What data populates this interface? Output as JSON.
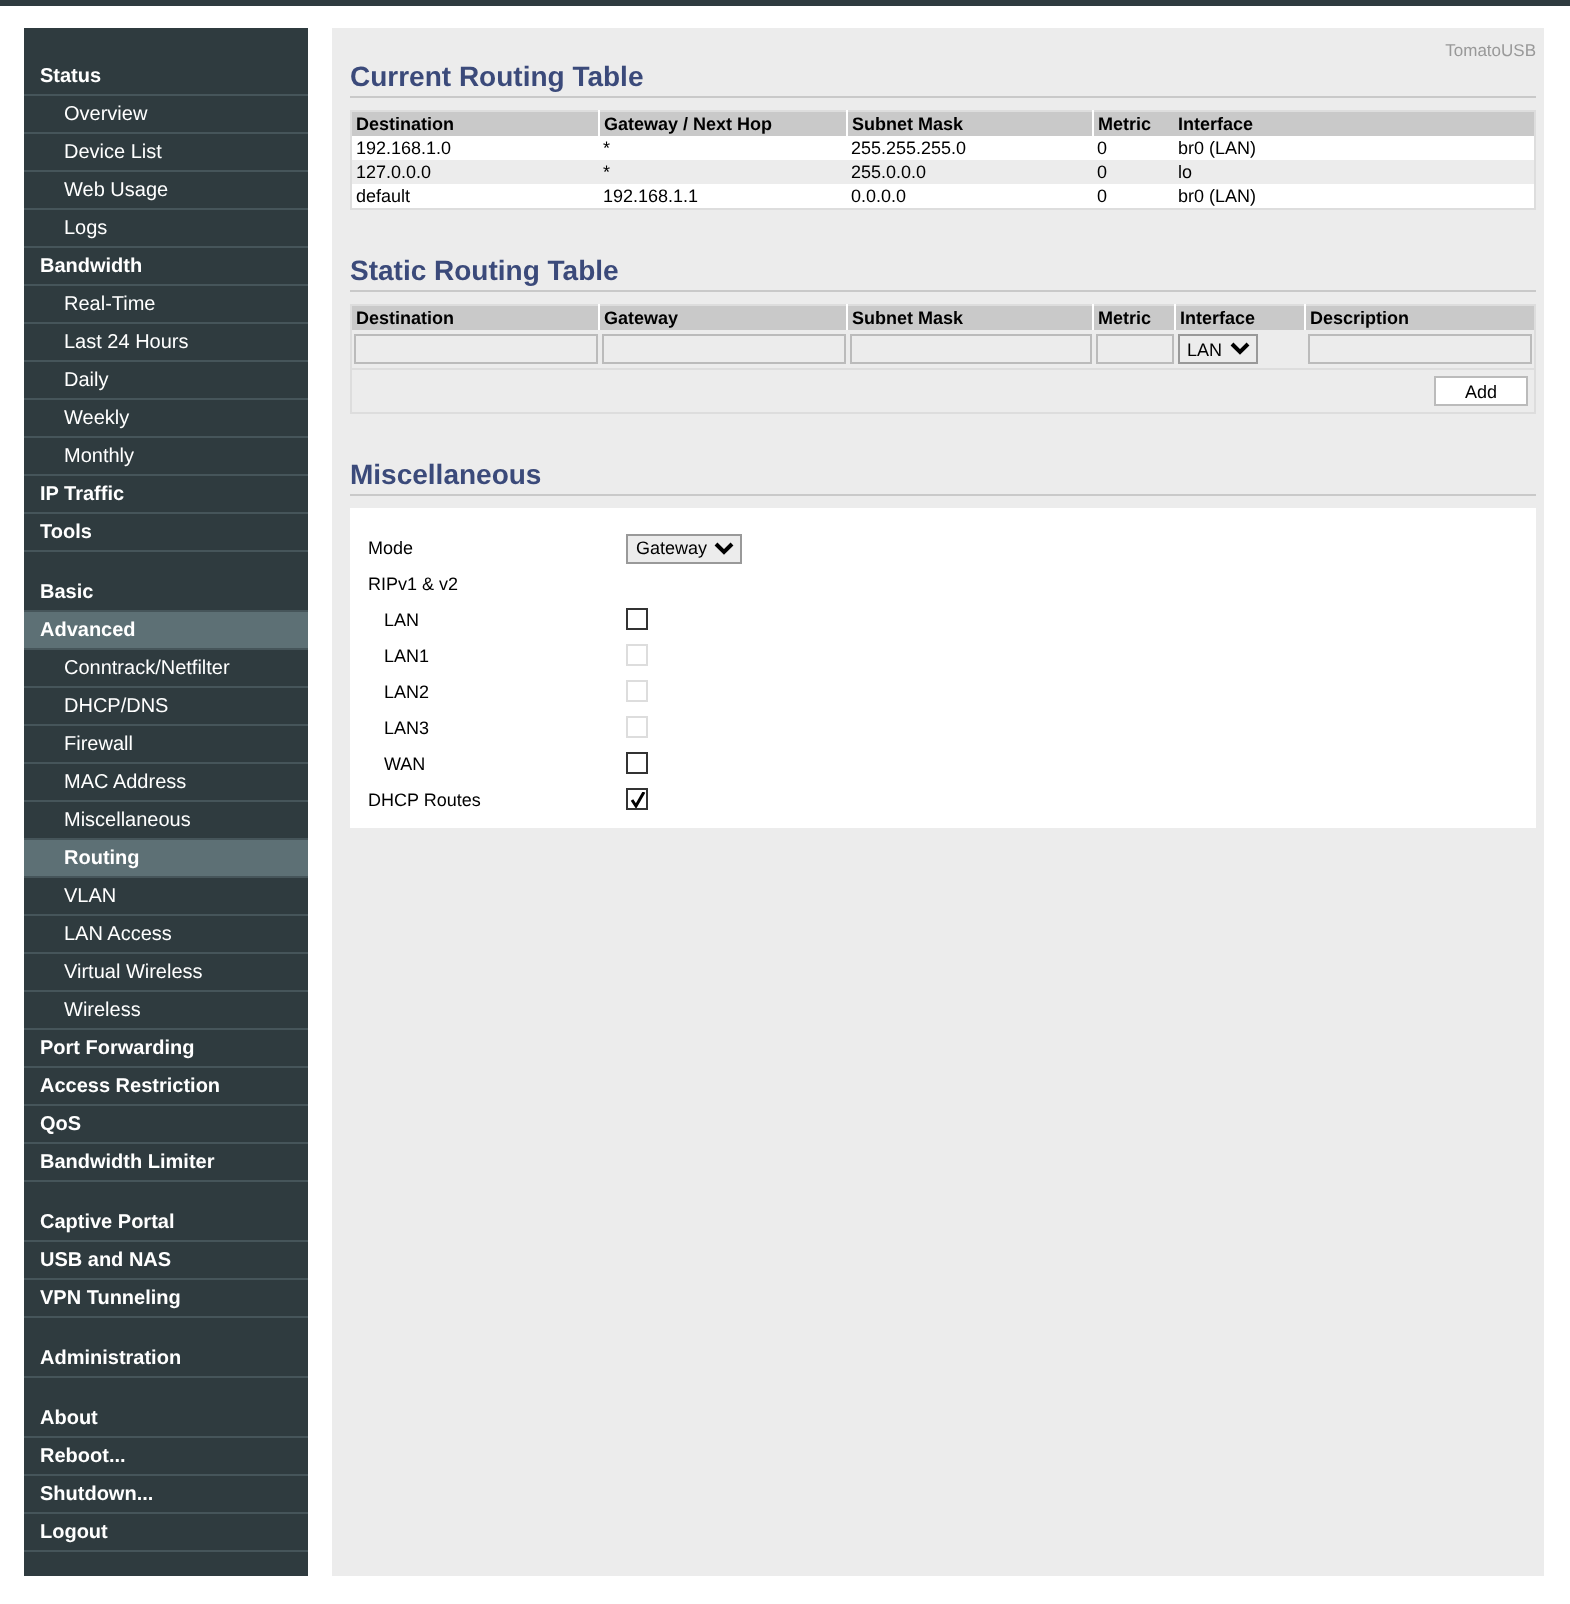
{
  "sidebar": {
    "groups": [
      [
        {
          "label": "Status",
          "selected": false,
          "children": [
            {
              "label": "Overview",
              "selected": false
            },
            {
              "label": "Device List",
              "selected": false
            },
            {
              "label": "Web Usage",
              "selected": false
            },
            {
              "label": "Logs",
              "selected": false
            }
          ]
        },
        {
          "label": "Bandwidth",
          "selected": false,
          "children": [
            {
              "label": "Real-Time",
              "selected": false
            },
            {
              "label": "Last 24 Hours",
              "selected": false
            },
            {
              "label": "Daily",
              "selected": false
            },
            {
              "label": "Weekly",
              "selected": false
            },
            {
              "label": "Monthly",
              "selected": false
            }
          ]
        },
        {
          "label": "IP Traffic",
          "selected": false
        },
        {
          "label": "Tools",
          "selected": false
        }
      ],
      [
        {
          "label": "Basic",
          "selected": false
        },
        {
          "label": "Advanced",
          "selected": true,
          "children": [
            {
              "label": "Conntrack/Netfilter",
              "selected": false
            },
            {
              "label": "DHCP/DNS",
              "selected": false
            },
            {
              "label": "Firewall",
              "selected": false
            },
            {
              "label": "MAC Address",
              "selected": false
            },
            {
              "label": "Miscellaneous",
              "selected": false
            },
            {
              "label": "Routing",
              "selected": true
            },
            {
              "label": "VLAN",
              "selected": false
            },
            {
              "label": "LAN Access",
              "selected": false
            },
            {
              "label": "Virtual Wireless",
              "selected": false
            },
            {
              "label": "Wireless",
              "selected": false
            }
          ]
        },
        {
          "label": "Port Forwarding",
          "selected": false
        },
        {
          "label": "Access Restriction",
          "selected": false
        },
        {
          "label": "QoS",
          "selected": false
        },
        {
          "label": "Bandwidth Limiter",
          "selected": false
        }
      ],
      [
        {
          "label": "Captive Portal",
          "selected": false
        },
        {
          "label": "USB and NAS",
          "selected": false
        },
        {
          "label": "VPN Tunneling",
          "selected": false
        }
      ],
      [
        {
          "label": "Administration",
          "selected": false
        }
      ],
      [
        {
          "label": "About",
          "selected": false
        },
        {
          "label": "Reboot...",
          "selected": false
        },
        {
          "label": "Shutdown...",
          "selected": false
        },
        {
          "label": "Logout",
          "selected": false
        }
      ]
    ]
  },
  "brand": "TomatoUSB",
  "current_routing": {
    "title": "Current Routing Table",
    "columns": [
      "Destination",
      "Gateway / Next Hop",
      "Subnet Mask",
      "Metric",
      "Interface"
    ],
    "rows": [
      [
        "192.168.1.0",
        "*",
        "255.255.255.0",
        "0",
        "br0 (LAN)"
      ],
      [
        "127.0.0.0",
        "*",
        "255.0.0.0",
        "0",
        "lo"
      ],
      [
        "default",
        "192.168.1.1",
        "0.0.0.0",
        "0",
        "br0 (LAN)"
      ]
    ]
  },
  "static_routing": {
    "title": "Static Routing Table",
    "columns": [
      "Destination",
      "Gateway",
      "Subnet Mask",
      "Metric",
      "Interface",
      "Description"
    ],
    "interface_value": "LAN",
    "add_button": "Add"
  },
  "miscellaneous": {
    "title": "Miscellaneous",
    "mode_label": "Mode",
    "mode_value": "Gateway",
    "rip_label": "RIPv1 & v2",
    "rip": [
      {
        "label": "LAN",
        "checked": false,
        "disabled": false
      },
      {
        "label": "LAN1",
        "checked": false,
        "disabled": true
      },
      {
        "label": "LAN2",
        "checked": false,
        "disabled": true
      },
      {
        "label": "LAN3",
        "checked": false,
        "disabled": true
      },
      {
        "label": "WAN",
        "checked": false,
        "disabled": false
      }
    ],
    "dhcp_routes": {
      "label": "DHCP Routes",
      "checked": true,
      "disabled": false
    }
  }
}
